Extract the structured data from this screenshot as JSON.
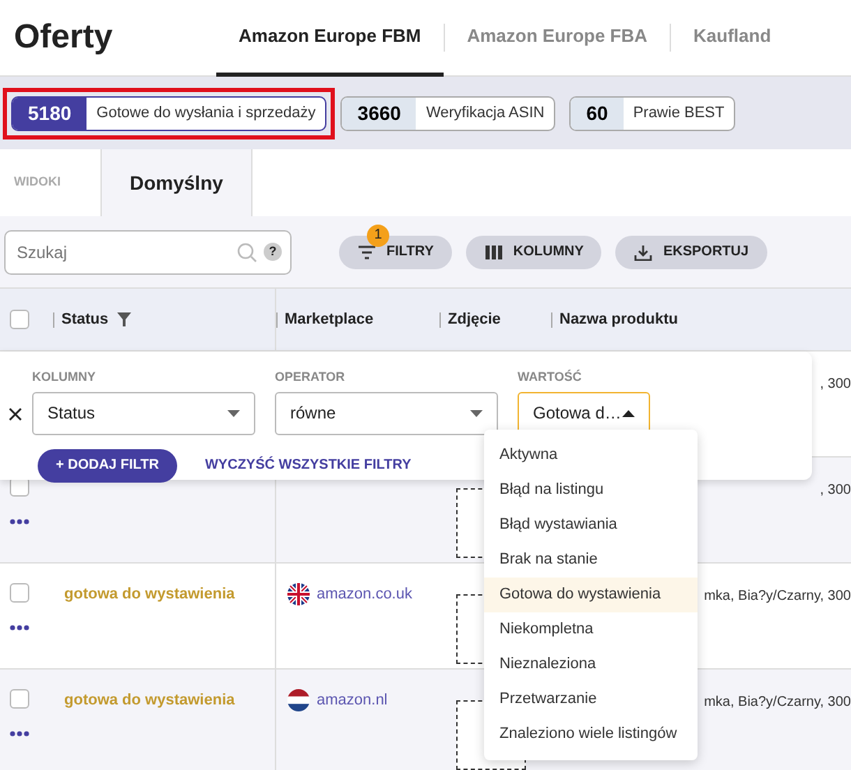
{
  "title": "Oferty",
  "tabs": [
    {
      "label": "Amazon Europe FBM",
      "selected": true
    },
    {
      "label": "Amazon Europe FBA",
      "selected": false
    },
    {
      "label": "Kaufland",
      "selected": false
    }
  ],
  "chips": [
    {
      "count": "5180",
      "label": "Gotowe do wysłania i sprzedaży",
      "selected": true,
      "highlighted": true
    },
    {
      "count": "3660",
      "label": "Weryfikacja ASIN",
      "selected": false,
      "highlighted": false
    },
    {
      "count": "60",
      "label": "Prawie BEST",
      "selected": false,
      "highlighted": false
    }
  ],
  "views": {
    "label": "WIDOKI",
    "tabs": [
      {
        "label": "Domyślny",
        "selected": true
      }
    ]
  },
  "search": {
    "placeholder": "Szukaj",
    "help": "?"
  },
  "buttons": [
    {
      "label": "FILTRY",
      "kind": "filter",
      "badge": "1"
    },
    {
      "label": "KOLUMNY",
      "kind": "columns"
    },
    {
      "label": "EKSPORTUJ",
      "kind": "export"
    }
  ],
  "table": {
    "select_all": {
      "checked": false
    },
    "columns": [
      {
        "label": "Status",
        "filtered": true
      },
      {
        "label": "Marketplace",
        "filtered": false
      },
      {
        "label": "Zdjęcie",
        "filtered": false
      },
      {
        "label": "Nazwa produktu",
        "filtered": false
      }
    ],
    "rows": [
      {
        "product": ", 300"
      },
      {
        "checked": false,
        "product": ", 300"
      },
      {
        "checked": false,
        "status": "gotowa do wystawienia",
        "marketplace": {
          "kind": "uk",
          "label": "amazon.co.uk"
        },
        "product": "mka, Bia?y/Czarny, 300"
      },
      {
        "checked": false,
        "status": "gotowa do wystawienia",
        "marketplace": {
          "kind": "nl",
          "label": "amazon.nl"
        },
        "product": "mka, Bia?y/Czarny, 300"
      }
    ]
  },
  "filter_panel": {
    "fields": [
      {
        "label": "KOLUMNY",
        "value": "Status",
        "open": false
      },
      {
        "label": "OPERATOR",
        "value": "równe",
        "open": false
      },
      {
        "label": "WARTOŚĆ",
        "value": "Gotowa d…",
        "open": true
      }
    ],
    "add_button": "+ DODAJ FILTR",
    "clear_link": "WYCZYŚĆ WSZYSTKIE FILTRY"
  },
  "dropdown": {
    "options": [
      {
        "label": "Aktywna",
        "selected": false
      },
      {
        "label": "Błąd na listingu",
        "selected": false
      },
      {
        "label": "Błąd wystawiania",
        "selected": false
      },
      {
        "label": "Brak na stanie",
        "selected": false
      },
      {
        "label": "Gotowa do wystawienia",
        "selected": true
      },
      {
        "label": "Niekompletna",
        "selected": false
      },
      {
        "label": "Nieznaleziona",
        "selected": false
      },
      {
        "label": "Przetwarzanie",
        "selected": false
      },
      {
        "label": "Znaleziono wiele listingów",
        "selected": false
      }
    ]
  }
}
